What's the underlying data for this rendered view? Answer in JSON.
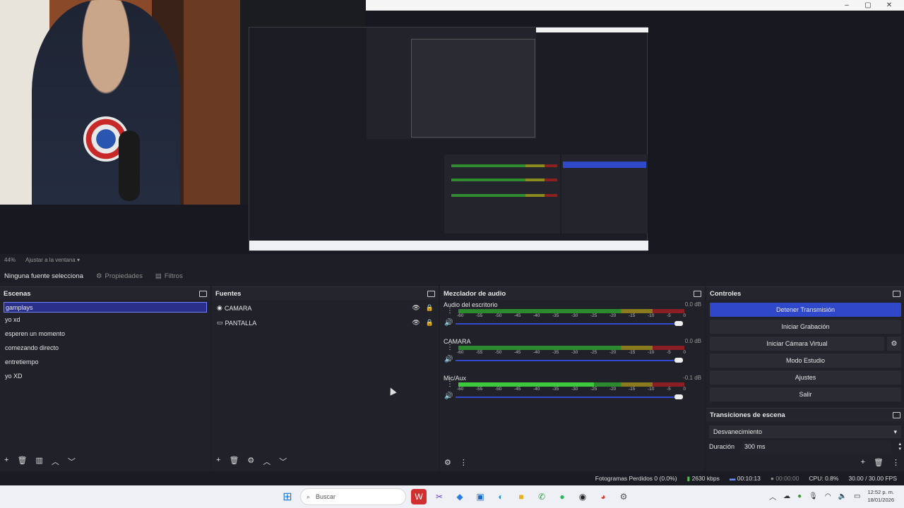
{
  "window_controls": {
    "minimize": "‒",
    "maximize": "▢",
    "close": "✕"
  },
  "preview": {
    "zoom": "44%",
    "fit_label": "Ajustar a la ventana"
  },
  "source_bar": {
    "no_source": "Ninguna fuente selecciona",
    "properties": "Propiedades",
    "filters": "Filtros"
  },
  "scenes": {
    "title": "Escenas",
    "items": [
      "gamplays",
      "yo xd",
      "esperen un momento",
      "comezando directo",
      "entretiempo",
      "yo XD"
    ],
    "selected": "gamplays"
  },
  "sources": {
    "title": "Fuentes",
    "items": [
      {
        "name": "CAMARA",
        "icon": "camera-icon"
      },
      {
        "name": "PANTALLA",
        "icon": "monitor-icon"
      }
    ]
  },
  "mixer": {
    "title": "Mezclador de audio",
    "ticks": [
      "-60",
      "-55",
      "-50",
      "-45",
      "-40",
      "-35",
      "-30",
      "-25",
      "-20",
      "-15",
      "-10",
      "-5",
      "0"
    ],
    "channels": [
      {
        "name": "Audio del escritorio",
        "db": "0.0 dB",
        "volume": 1.0
      },
      {
        "name": "CAMARA",
        "db": "0.0 dB",
        "volume": 1.0
      },
      {
        "name": "Mic/Aux",
        "db": "-0.1 dB",
        "volume": 0.98
      }
    ]
  },
  "controls": {
    "title": "Controles",
    "stop_stream": "Detener Transmisión",
    "start_recording": "Iniciar Grabación",
    "start_virtual_cam": "Iniciar Cámara Virtual",
    "studio_mode": "Modo Estudio",
    "settings": "Ajustes",
    "exit": "Salir"
  },
  "transitions": {
    "title": "Transiciones de escena",
    "selected": "Desvanecimiento",
    "duration_label": "Duración",
    "duration_value": "300 ms"
  },
  "status_bar": {
    "dropped_frames": "Fotogramas Perdidos 0 (0.0%)",
    "bitrate": "2630 kbps",
    "stream_time": "00:10:13",
    "rec_time": "00:00:00",
    "cpu": "CPU: 0.8%",
    "fps": "30.00 / 30.00 FPS"
  },
  "taskbar": {
    "search_placeholder": "Buscar",
    "time": "12:52 p. m.",
    "date": "18/01/2026"
  },
  "colors": {
    "accent_blue": "#2f48c9",
    "panel_bg": "#202129",
    "meter_green": "#2b8a2e",
    "meter_yellow": "#8a7a1e",
    "meter_red": "#8a1e24"
  }
}
